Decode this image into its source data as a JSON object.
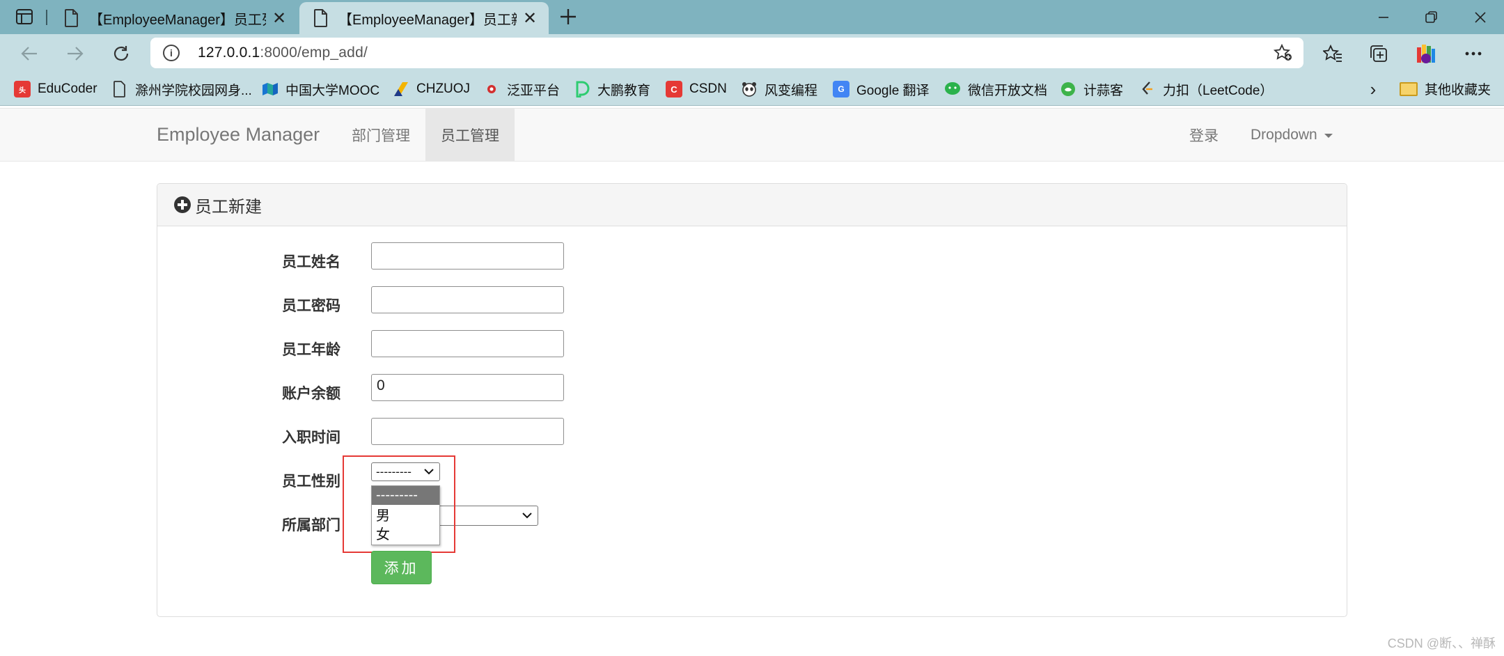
{
  "browser": {
    "tabs": [
      {
        "title": "【EmployeeManager】员工列表",
        "active": false
      },
      {
        "title": "【EmployeeManager】员工新建",
        "active": true
      }
    ],
    "url": {
      "host": "127.0.0.1",
      "path": ":8000/emp_add/"
    },
    "new_tab_icon": "+",
    "bookmarks": [
      {
        "label": "EduCoder",
        "icon": "toutiao-icon",
        "color": "#e53935"
      },
      {
        "label": "滁州学院校园网身...",
        "icon": "document-icon",
        "color": "#ffffff"
      },
      {
        "label": "中国大学MOOC",
        "icon": "mooc-icon",
        "color": "#2e7d8c"
      },
      {
        "label": "CHZUOJ",
        "icon": "chzuoj-icon",
        "color": "#f4b400"
      },
      {
        "label": "泛亚平台",
        "icon": "fanya-icon",
        "color": "#d32f2f"
      },
      {
        "label": "大鹏教育",
        "icon": "dapeng-icon",
        "color": "#2ecc71"
      },
      {
        "label": "CSDN",
        "icon": "csdn-icon",
        "color": "#e53935"
      },
      {
        "label": "风变编程",
        "icon": "panda-icon",
        "color": "#444444"
      },
      {
        "label": "Google 翻译",
        "icon": "google-translate-icon",
        "color": "#4285f4"
      },
      {
        "label": "微信开放文档",
        "icon": "wechat-icon",
        "color": "#2bb24c"
      },
      {
        "label": "计蒜客",
        "icon": "jisuanke-icon",
        "color": "#3db34a"
      },
      {
        "label": "力扣（LeetCode）",
        "icon": "leetcode-icon",
        "color": "#f89f1b"
      }
    ],
    "other_bookmarks": "其他收藏夹"
  },
  "navbar": {
    "brand": "Employee Manager",
    "items": [
      {
        "label": "部门管理",
        "active": false
      },
      {
        "label": "员工管理",
        "active": true
      }
    ],
    "login": "登录",
    "dropdown": "Dropdown"
  },
  "panel": {
    "title": "员工新建"
  },
  "form": {
    "fields": [
      {
        "label": "员工姓名",
        "value": ""
      },
      {
        "label": "员工密码",
        "value": ""
      },
      {
        "label": "员工年龄",
        "value": ""
      },
      {
        "label": "账户余额",
        "value": "0"
      },
      {
        "label": "入职时间",
        "value": ""
      }
    ],
    "gender": {
      "label": "员工性别",
      "selected": "---------",
      "options": [
        "---------",
        "男",
        "女"
      ]
    },
    "department": {
      "label": "所属部门",
      "selected": ""
    },
    "submit": "添加"
  },
  "watermark": "CSDN @断、、禅酥",
  "colors": {
    "tabstrip": "#7fb3bf",
    "toolbar": "#c6dee3",
    "success_button": "#5cb85c",
    "annotation": "#e53935"
  }
}
